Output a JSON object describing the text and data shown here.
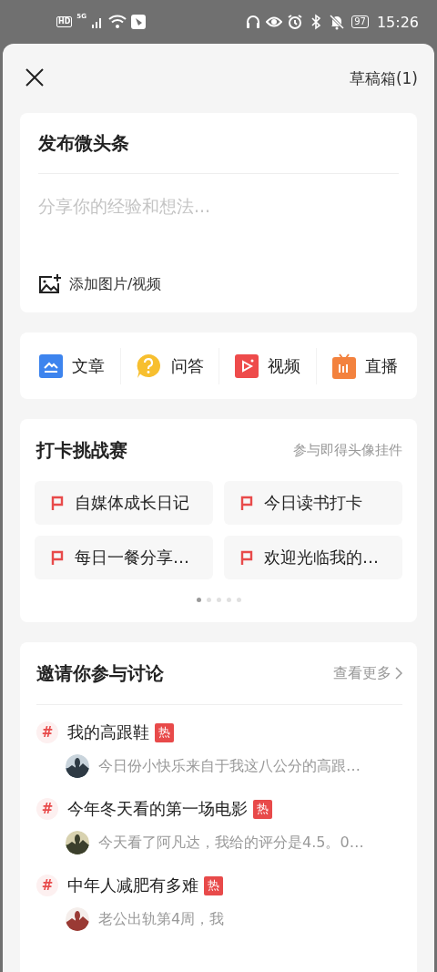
{
  "status_bar": {
    "network_labels": [
      "HD",
      "5G"
    ],
    "battery": "97",
    "time": "15:26"
  },
  "header": {
    "draft_box": "草稿箱(1)"
  },
  "compose": {
    "title": "发布微头条",
    "placeholder": "分享你的经验和想法...",
    "add_media": "添加图片/视频"
  },
  "post_types": [
    {
      "kind": "article",
      "label": "文章"
    },
    {
      "kind": "qa",
      "label": "问答"
    },
    {
      "kind": "video",
      "label": "视频"
    },
    {
      "kind": "live",
      "label": "直播"
    }
  ],
  "challenges": {
    "title": "打卡挑战赛",
    "subtitle": "参与即得头像挂件",
    "items": [
      "自媒体成长日记",
      "今日读书打卡",
      "每日一餐分享…",
      "欢迎光临我的…"
    ],
    "pages": [
      {
        "selected": true
      },
      {
        "selected": false
      },
      {
        "selected": false
      },
      {
        "selected": false
      },
      {
        "selected": false
      }
    ]
  },
  "discussions": {
    "title": "邀请你参与讨论",
    "more": "查看更多",
    "topics": [
      {
        "hashtag": "#",
        "title": "我的高跟鞋",
        "badge": "热",
        "comment": "今日份小快乐来自于我这八公分的高跟…"
      },
      {
        "hashtag": "#",
        "title": "今年冬天看的第一场电影",
        "badge": "热",
        "comment": "今天看了阿凡达，我给的评分是4.5。0…"
      },
      {
        "hashtag": "#",
        "title": "中年人减肥有多难",
        "badge": "热",
        "comment": "老公出轨第4周，我"
      }
    ]
  }
}
